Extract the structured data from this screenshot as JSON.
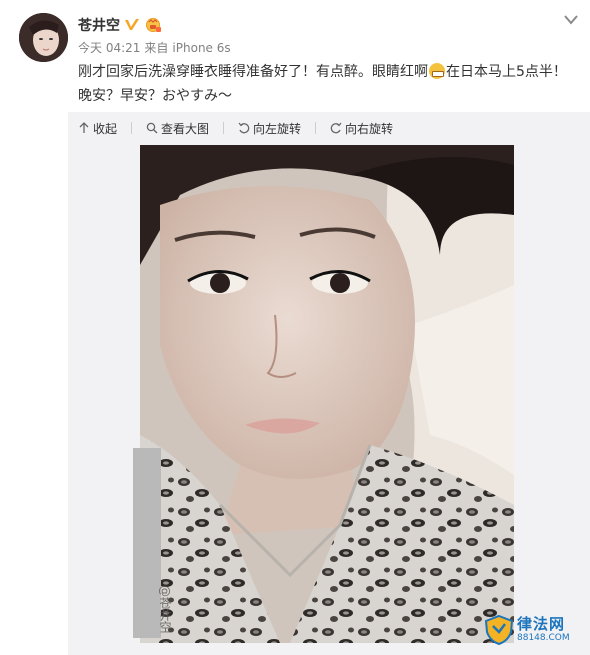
{
  "user": {
    "name": "苍井空",
    "time": "今天 04:21",
    "source_prefix": "来自",
    "device": "iPhone 6s"
  },
  "post": {
    "text_part1": "刚才回家后洗澡穿睡衣睡得准备好了！有点醉。眼睛红啊",
    "text_part2": "在日本马上5点半！",
    "text_line2": "晚安？早安？おやすみ～"
  },
  "toolbar": {
    "collapse": "收起",
    "view_large": "查看大图",
    "rotate_left": "向左旋转",
    "rotate_right": "向右旋转"
  },
  "photo": {
    "watermark": "@苍井空"
  },
  "site_logo": {
    "brand": "律法网",
    "domain": "88148.COM"
  },
  "colors": {
    "brand_blue": "#1c75bc",
    "verified_gold": "#f5a623",
    "meta_gray": "#808080"
  }
}
